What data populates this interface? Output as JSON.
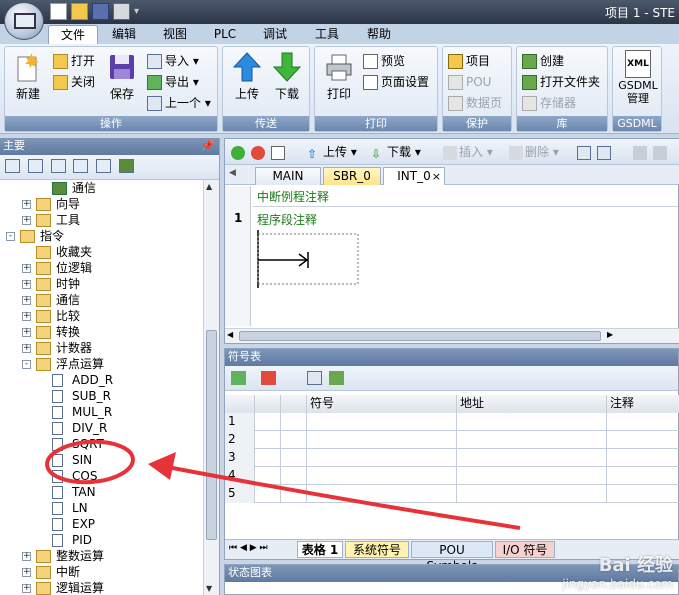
{
  "window": {
    "title": "项目 1 - STE"
  },
  "ribbon": {
    "tabs": [
      {
        "label": "文件"
      },
      {
        "label": "编辑"
      },
      {
        "label": "视图"
      },
      {
        "label": "PLC"
      },
      {
        "label": "调试"
      },
      {
        "label": "工具"
      },
      {
        "label": "帮助"
      }
    ],
    "groups": {
      "operation": {
        "label": "操作",
        "new": "新建",
        "open": "打开",
        "close": "关闭",
        "save": "保存",
        "import": "导入",
        "export": "导出",
        "previous": "上一个"
      },
      "transfer": {
        "label": "传送",
        "upload": "上传",
        "download": "下载"
      },
      "print": {
        "label": "打印",
        "print": "打印",
        "preview": "预览",
        "page_setup": "页面设置"
      },
      "protect": {
        "label": "保护",
        "project": "项目",
        "pou": "POU",
        "data_page": "数据页"
      },
      "library": {
        "label": "库",
        "create": "创建",
        "open_folder": "打开文件夹",
        "memory": "存储器"
      },
      "gsdml": {
        "label": "GSDML",
        "manage": "GSDML\n管理",
        "xml": "XML"
      }
    }
  },
  "left_pane": {
    "title": "主要",
    "tree": [
      {
        "label": "通信",
        "level": 2,
        "expander": "",
        "icon": "pc"
      },
      {
        "label": "向导",
        "level": 1,
        "expander": "+",
        "icon": "folder"
      },
      {
        "label": "工具",
        "level": 1,
        "expander": "+",
        "icon": "folder"
      },
      {
        "label": "指令",
        "level": 0,
        "expander": "-",
        "icon": "folder"
      },
      {
        "label": "收藏夹",
        "level": 1,
        "expander": "",
        "icon": "folder"
      },
      {
        "label": "位逻辑",
        "level": 1,
        "expander": "+",
        "icon": "folder"
      },
      {
        "label": "时钟",
        "level": 1,
        "expander": "+",
        "icon": "folder"
      },
      {
        "label": "通信",
        "level": 1,
        "expander": "+",
        "icon": "folder"
      },
      {
        "label": "比较",
        "level": 1,
        "expander": "+",
        "icon": "folder"
      },
      {
        "label": "转换",
        "level": 1,
        "expander": "+",
        "icon": "folder"
      },
      {
        "label": "计数器",
        "level": 1,
        "expander": "+",
        "icon": "folder"
      },
      {
        "label": "浮点运算",
        "level": 1,
        "expander": "-",
        "icon": "folder"
      },
      {
        "label": "ADD_R",
        "level": 2,
        "expander": "",
        "icon": "fn"
      },
      {
        "label": "SUB_R",
        "level": 2,
        "expander": "",
        "icon": "fn"
      },
      {
        "label": "MUL_R",
        "level": 2,
        "expander": "",
        "icon": "fn"
      },
      {
        "label": "DIV_R",
        "level": 2,
        "expander": "",
        "icon": "fn"
      },
      {
        "label": "SQRT",
        "level": 2,
        "expander": "",
        "icon": "fn"
      },
      {
        "label": "SIN",
        "level": 2,
        "expander": "",
        "icon": "fn"
      },
      {
        "label": "COS",
        "level": 2,
        "expander": "",
        "icon": "fn"
      },
      {
        "label": "TAN",
        "level": 2,
        "expander": "",
        "icon": "fn"
      },
      {
        "label": "LN",
        "level": 2,
        "expander": "",
        "icon": "fn"
      },
      {
        "label": "EXP",
        "level": 2,
        "expander": "",
        "icon": "fn"
      },
      {
        "label": "PID",
        "level": 2,
        "expander": "",
        "icon": "fn"
      },
      {
        "label": "整数运算",
        "level": 1,
        "expander": "+",
        "icon": "folder"
      },
      {
        "label": "中断",
        "level": 1,
        "expander": "+",
        "icon": "folder"
      },
      {
        "label": "逻辑运算",
        "level": 1,
        "expander": "+",
        "icon": "folder"
      }
    ]
  },
  "editor": {
    "toolbar": {
      "upload": "上传",
      "download": "下载",
      "insert": "插入",
      "delete": "删除"
    },
    "tabs": [
      {
        "label": "MAIN"
      },
      {
        "label": "SBR_0"
      },
      {
        "label": "INT_0"
      }
    ],
    "routine_comment": "中断例程注释",
    "network_number": "1",
    "network_comment": "程序段注释"
  },
  "symbol_table": {
    "title": "符号表",
    "columns": [
      "符号",
      "地址",
      "注释"
    ],
    "rows": [
      "1",
      "2",
      "3",
      "4",
      "5"
    ],
    "tabs": [
      {
        "label": "表格 1"
      },
      {
        "label": "系统符号"
      },
      {
        "label": "POU Symbols"
      },
      {
        "label": "I/O 符号"
      }
    ]
  },
  "status_chart": {
    "title": "状态图表"
  },
  "watermark": {
    "name": "Bai 经验",
    "url": "jingyan.baidu.com"
  },
  "colors": {
    "annotation": "#e8323a",
    "ribbon_accent": "#6c87ad"
  }
}
